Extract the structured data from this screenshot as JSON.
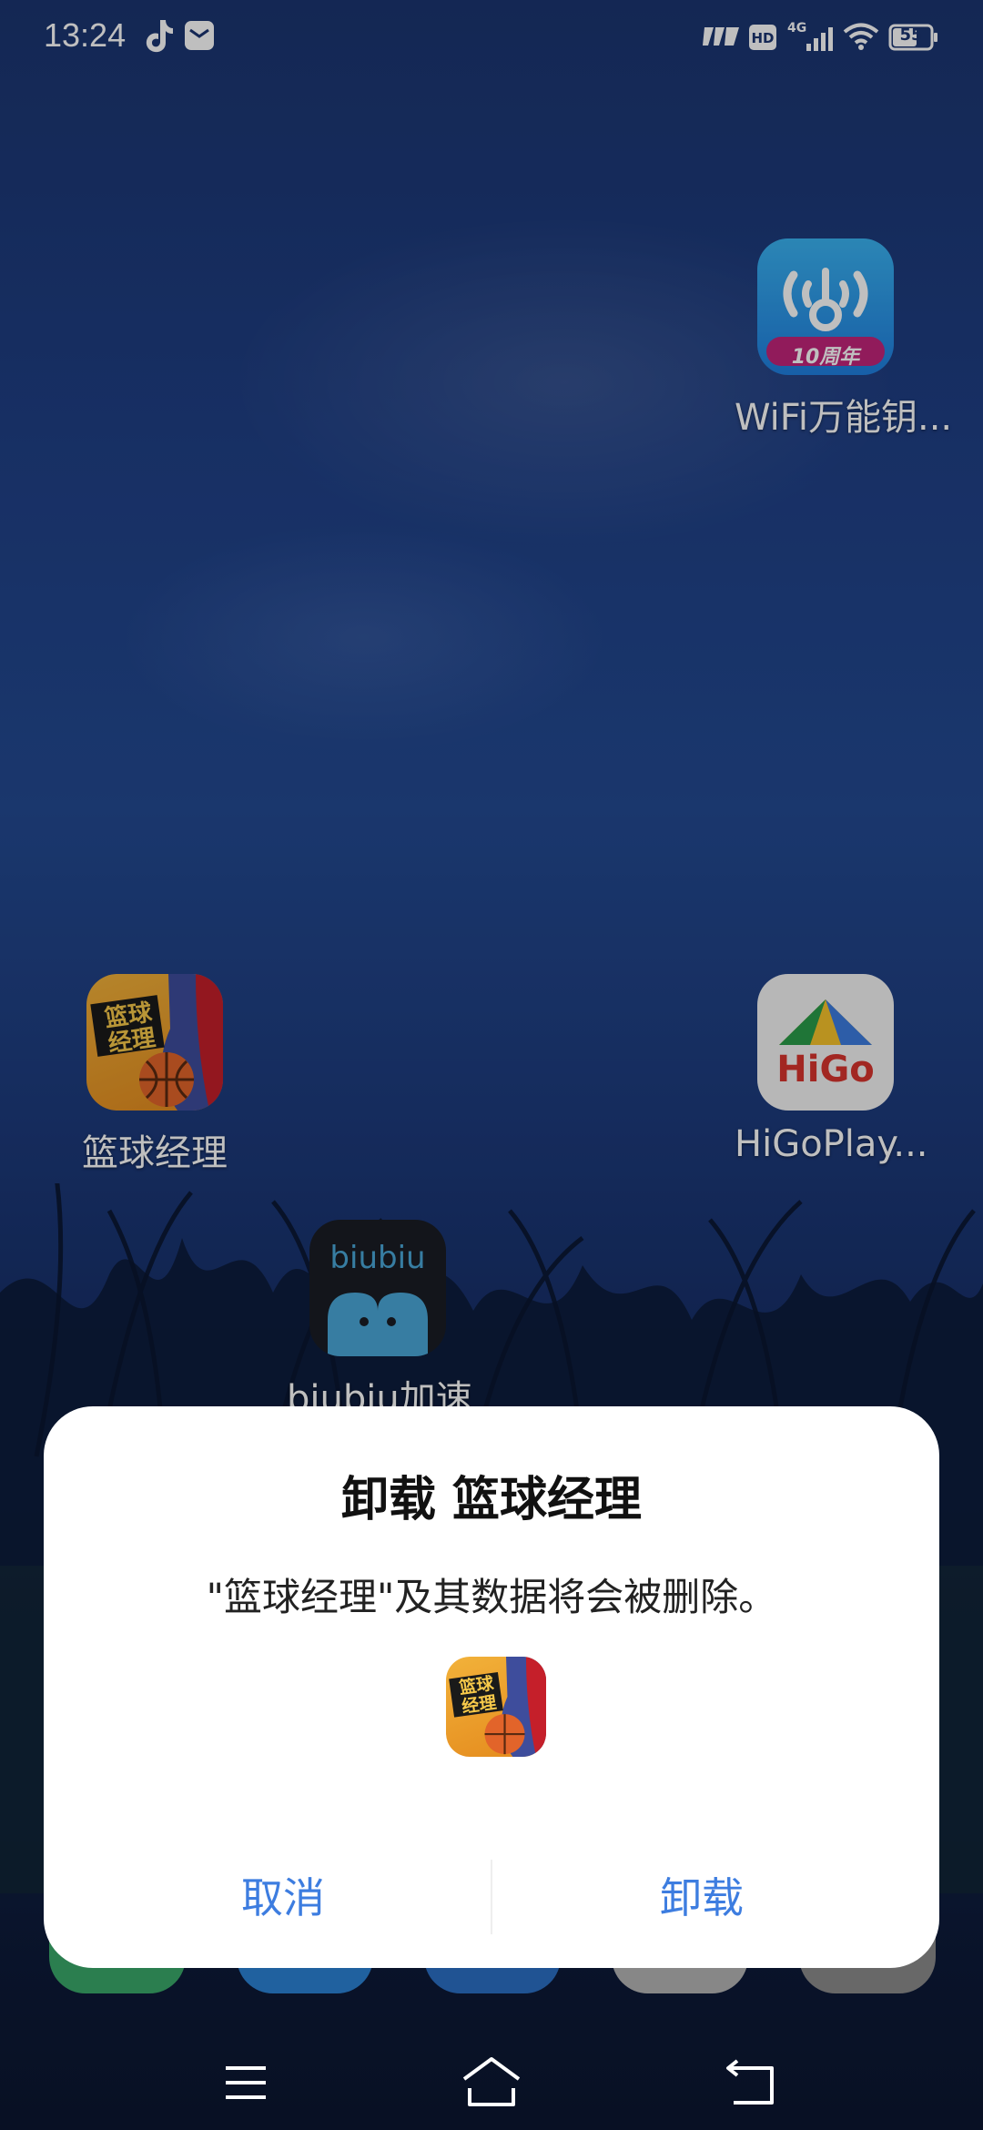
{
  "status_bar": {
    "time": "13:24",
    "left_icons": [
      "tiktok-icon",
      "mail-notification-icon"
    ],
    "right_icons": [
      "volte-icon",
      "hd-icon",
      "signal-4g-icon",
      "wifi-icon",
      "battery-icon"
    ],
    "network": "4G",
    "hd": "HD",
    "battery": "55"
  },
  "home": {
    "apps": [
      {
        "name": "WiFi万能钥...",
        "icon": "wifi-key-icon",
        "badge": "10周年"
      },
      {
        "name": "篮球经理",
        "icon": "basketball-manager-icon",
        "icon_text": "篮球经理"
      },
      {
        "name": "HiGoPlay...",
        "icon": "higoplay-icon",
        "icon_text": "HiGo"
      },
      {
        "name": "biubiu加速",
        "icon": "biubiu-icon",
        "icon_text": "biubiu"
      }
    ]
  },
  "dialog": {
    "title": "卸载 篮球经理",
    "message": "\"篮球经理\"及其数据将会被删除。",
    "app_icon": "basketball-manager-icon",
    "cancel_label": "取消",
    "confirm_label": "卸载",
    "accent_color": "#3d7de0"
  },
  "nav_bar": {
    "buttons": [
      "menu-icon",
      "home-icon",
      "back-icon"
    ]
  }
}
